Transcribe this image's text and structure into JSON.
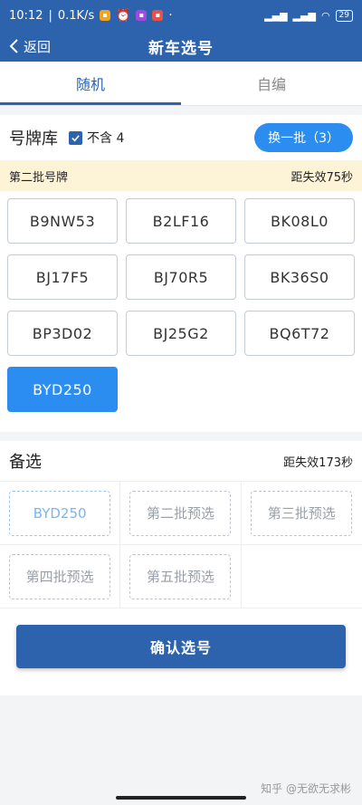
{
  "status_bar": {
    "time": "10:12",
    "separator": "|",
    "speed": "0.1K/s",
    "dot": "·",
    "battery": "29",
    "colors": {
      "app1": "#f2a41c",
      "app2": "#a04ae0",
      "app3": "#e8504a"
    }
  },
  "nav": {
    "back_label": "返回",
    "title": "新车选号"
  },
  "tabs": [
    {
      "label": "随机",
      "active": true
    },
    {
      "label": "自编",
      "active": false
    }
  ],
  "pool": {
    "title": "号牌库",
    "checkbox_label": "不含 4",
    "checkbox_checked": true,
    "refresh_button": "换一批（3）"
  },
  "batch": {
    "label": "第二批号牌",
    "countdown": "距失效75秒"
  },
  "plates": [
    "B9NW53",
    "B2LF16",
    "BK08L0",
    "BJ17F5",
    "BJ70R5",
    "BK36S0",
    "BP3D02",
    "BJ25G2",
    "BQ6T72",
    "BYD250"
  ],
  "selected_plate": "BYD250",
  "backup": {
    "title": "备选",
    "countdown": "距失效173秒",
    "slots": [
      "BYD250",
      "第二批预选",
      "第三批预选",
      "第四批预选",
      "第五批预选"
    ]
  },
  "confirm_button": "确认选号",
  "watermark": "知乎 @无欲无求彬",
  "colors": {
    "primary": "#2d63ad",
    "accent": "#2b8df0",
    "batch_bg": "#fdf4d8"
  }
}
